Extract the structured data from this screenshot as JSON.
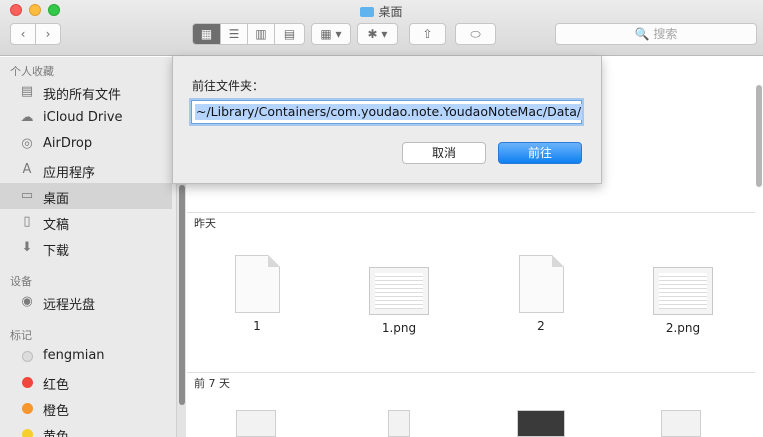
{
  "window": {
    "title": "桌面"
  },
  "toolbar": {
    "back_glyph": "‹",
    "forward_glyph": "›",
    "view_icon_glyph": "▦",
    "view_list_glyph": "☰",
    "view_column_glyph": "▥",
    "view_flow_glyph": "▤",
    "arrange_glyph": "▦ ▾",
    "action_glyph": "✱ ▾",
    "share_glyph": "⇧",
    "tag_glyph": "⬭",
    "search_placeholder": "🔍 搜索"
  },
  "sidebar": {
    "favorites_header": "个人收藏",
    "favorites": [
      {
        "label": "我的所有文件",
        "icon": "all-files-icon",
        "glyph": "▤"
      },
      {
        "label": "iCloud Drive",
        "icon": "cloud-icon",
        "glyph": "☁"
      },
      {
        "label": "AirDrop",
        "icon": "airdrop-icon",
        "glyph": "◎"
      },
      {
        "label": "应用程序",
        "icon": "applications-icon",
        "glyph": "A"
      },
      {
        "label": "桌面",
        "icon": "desktop-icon",
        "glyph": "▭",
        "selected": true
      },
      {
        "label": "文稿",
        "icon": "documents-icon",
        "glyph": "▯"
      },
      {
        "label": "下载",
        "icon": "download-icon",
        "glyph": "⬇"
      }
    ],
    "devices_header": "设备",
    "devices": [
      {
        "label": "远程光盘",
        "icon": "disc-icon",
        "glyph": "◉"
      }
    ],
    "tags_header": "标记",
    "tags": [
      {
        "label": "fengmian",
        "color": "#dcdcdc"
      },
      {
        "label": "红色",
        "color": "#f0463c"
      },
      {
        "label": "橙色",
        "color": "#f7962d"
      },
      {
        "label": "黄色",
        "color": "#f7cf2d"
      }
    ]
  },
  "main": {
    "groups": [
      {
        "header": "昨天",
        "files": [
          {
            "name": "1",
            "kind": "doc"
          },
          {
            "name": "1.png",
            "kind": "image"
          },
          {
            "name": "2",
            "kind": "doc"
          },
          {
            "name": "2.png",
            "kind": "image"
          }
        ]
      },
      {
        "header": "前 7 天"
      }
    ]
  },
  "goto_sheet": {
    "title": "前往文件夹：",
    "path": "~/Library/Containers/com.youdao.note.YoudaoNoteMac/Data/",
    "cancel_label": "取消",
    "go_label": "前往"
  },
  "colors": {
    "accent": "#0d80f2",
    "selection": "#b5d5ff"
  }
}
